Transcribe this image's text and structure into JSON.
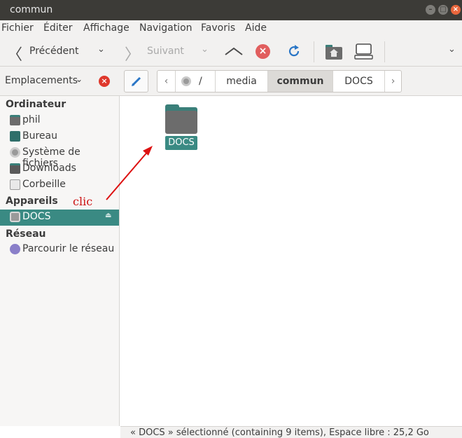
{
  "window": {
    "title": "commun"
  },
  "menu": [
    "Fichier",
    "Éditer",
    "Affichage",
    "Navigation",
    "Favoris",
    "Aide"
  ],
  "toolbar": {
    "back_label": "Précédent",
    "forward_label": "Suivant"
  },
  "location": {
    "places_label": "Emplacements",
    "path": [
      "/",
      "media",
      "commun",
      "DOCS"
    ],
    "active": "commun"
  },
  "sidebar": {
    "sections": [
      {
        "title": "Ordinateur",
        "items": [
          "phil",
          "Bureau",
          "Système de fichiers",
          "Downloads",
          "Corbeille"
        ]
      },
      {
        "title": "Appareils",
        "items": [
          "DOCS"
        ]
      },
      {
        "title": "Réseau",
        "items": [
          "Parcourir le réseau"
        ]
      }
    ],
    "selected": "DOCS"
  },
  "content": {
    "items": [
      {
        "name": "DOCS",
        "type": "folder",
        "selected": true
      }
    ]
  },
  "annotation": {
    "text": "clic",
    "color": "#cc1111"
  },
  "status": {
    "text": "« DOCS » sélectionné (containing 9 items), Espace libre : 25,2 Go"
  },
  "colors": {
    "accent": "#3a8a83",
    "titlebar": "#3c3b37",
    "close": "#e9663c"
  }
}
